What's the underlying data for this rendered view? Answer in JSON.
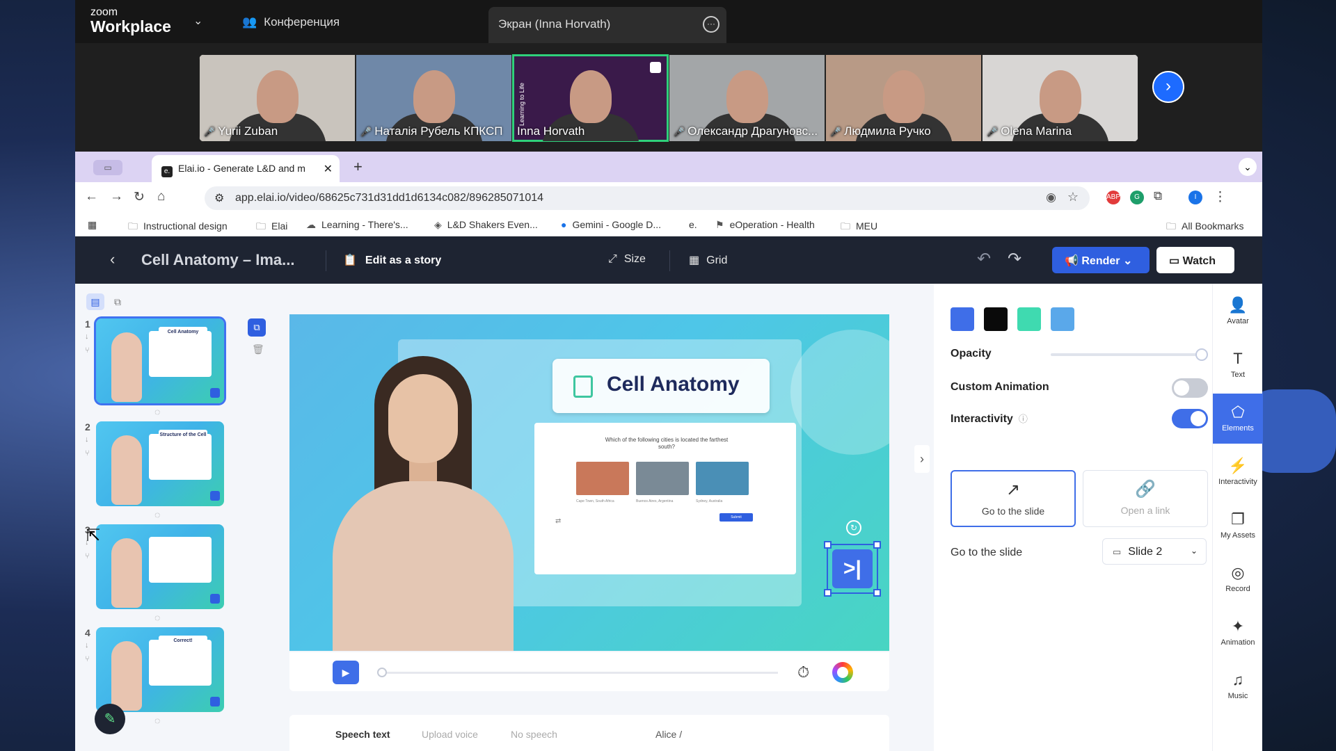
{
  "zoom": {
    "logo_small": "zoom",
    "logo_big": "Workplace",
    "meeting_label": "Конференция",
    "screen_tab": "Экран (Inna Horvath)"
  },
  "participants": [
    {
      "name": "Yurii Zuban",
      "muted": true,
      "bg": "#c9c4bd"
    },
    {
      "name": "Наталія Рубель КПКСП",
      "muted": true,
      "bg": "#6f88a8"
    },
    {
      "name": "Inna Horvath",
      "muted": false,
      "bg": "#3a1a4a",
      "overlay": "Learning to Life"
    },
    {
      "name": "Олександр Драгуновс...",
      "muted": true,
      "bg": "#a3a6a8"
    },
    {
      "name": "Людмила Ручко",
      "muted": true,
      "bg": "#b89a86"
    },
    {
      "name": "Olena Marina",
      "muted": true,
      "bg": "#d8d6d4"
    }
  ],
  "browser": {
    "tab_title": "Elai.io - Generate L&D and m",
    "url": "app.elai.io/video/68625c731d31dd1d6134c082/896285071014",
    "bookmarks": [
      "Instructional design",
      "Elai",
      "Learning - There's...",
      "L&D Shakers Even...",
      "Gemini - Google D...",
      "eOperation - Health",
      "MEU"
    ],
    "all_bookmarks": "All Bookmarks",
    "ext_labels": [
      "ABP",
      "G",
      "I"
    ]
  },
  "editor": {
    "title": "Cell Anatomy – Ima...",
    "edit_story": "Edit as a story",
    "size": "Size",
    "grid": "Grid",
    "render": "Render",
    "watch": "Watch"
  },
  "slides": [
    {
      "number": "1",
      "selected": true,
      "header": "Cell Anatomy"
    },
    {
      "number": "2",
      "selected": false,
      "header": "Structure of the Cell"
    },
    {
      "number": "3",
      "selected": false,
      "header": ""
    },
    {
      "number": "4",
      "selected": false,
      "header": "Correct!"
    }
  ],
  "canvas": {
    "title": "Cell Anatomy",
    "question": "Which of the following cities is located the farthest south?",
    "images": [
      {
        "caption": "Cape Town, South Africa",
        "color": "#c9785a"
      },
      {
        "caption": "Buenos Aires, Argentina",
        "color": "#7a8a96"
      },
      {
        "caption": "Sydney, Australia",
        "color": "#4a8fb6"
      }
    ],
    "submit": "Submit",
    "skip_icon": ">|"
  },
  "bottom_tabs": [
    "Speech text",
    "Upload voice",
    "No speech",
    "Alice /"
  ],
  "properties": {
    "colors": [
      "#3f6ee8",
      "#0a0a0a",
      "#3fdab0",
      "#5aa8ea"
    ],
    "opacity_label": "Opacity",
    "opacity_value": 1.0,
    "custom_animation_label": "Custom Animation",
    "custom_animation_on": false,
    "interactivity_label": "Interactivity",
    "interactivity_on": true,
    "option_slide": "Go to the slide",
    "option_link": "Open a link",
    "go_to_label": "Go to the slide",
    "go_to_value": "Slide 2"
  },
  "rail": [
    {
      "label": "Avatar",
      "icon": "person-icon",
      "active": false
    },
    {
      "label": "Text",
      "icon": "text-icon",
      "active": false
    },
    {
      "label": "Elements",
      "icon": "shapes-icon",
      "active": true
    },
    {
      "label": "Interactivity",
      "icon": "bolt-icon",
      "active": false
    },
    {
      "label": "My Assets",
      "icon": "assets-icon",
      "active": false
    },
    {
      "label": "Record",
      "icon": "record-icon",
      "active": false
    },
    {
      "label": "Animation",
      "icon": "sparkle-icon",
      "active": false
    },
    {
      "label": "Music",
      "icon": "music-icon",
      "active": false
    }
  ]
}
